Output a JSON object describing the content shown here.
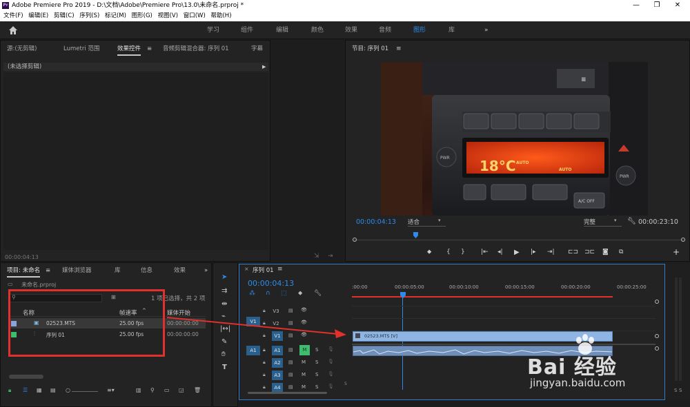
{
  "window": {
    "title": "Adobe Premiere Pro 2019 - D:\\文档\\Adobe\\Premiere Pro\\13.0\\未命名.prproj *",
    "app_badge": "Pr",
    "controls": [
      "—",
      "❐",
      "✕"
    ]
  },
  "menu": [
    "文件(F)",
    "编辑(E)",
    "剪辑(C)",
    "序列(S)",
    "标记(M)",
    "图形(G)",
    "视图(V)",
    "窗口(W)",
    "帮助(H)"
  ],
  "workspaces": {
    "items": [
      "学习",
      "组件",
      "编辑",
      "颜色",
      "效果",
      "音频",
      "图形",
      "库"
    ],
    "active": "图形",
    "more": "»"
  },
  "source_panel": {
    "tabs": [
      "源:(无剪辑)",
      "Lumetri 范围",
      "效果控件",
      "音频剪辑混合器: 序列 01",
      "字幕"
    ],
    "active_tab": "效果控件",
    "menu_glyph": "≡",
    "no_clip": "(未选择剪辑)",
    "timecode": "00:00:04:13"
  },
  "program_monitor": {
    "title": "节目: 序列 01",
    "timecode": "00:00:04:13",
    "fit": "适合",
    "quality": "完整",
    "duration": "00:00:23:10",
    "screen_text": [
      "AUTO",
      "AUTO",
      "18°C",
      "PWR",
      "PWR",
      "A/C OFF"
    ]
  },
  "project_panel": {
    "tabs": [
      "项目: 未命名",
      "媒体浏览器",
      "库",
      "信息",
      "效果"
    ],
    "active_tab": "项目: 未命名",
    "project_file": "未命名.prproj",
    "selection_info": "1 项已选择，共 2 项",
    "columns": [
      "名称",
      "帧速率",
      "媒体开始"
    ],
    "rows": [
      {
        "name": "02523.MTS",
        "fps": "25.00 fps",
        "start": "00:00:00:00",
        "color": "#8aa6d8"
      },
      {
        "name": "序列 01",
        "fps": "25.00 fps",
        "start": "00:00:00:00",
        "color": "#3fbd6e"
      }
    ]
  },
  "timeline": {
    "tab": "序列 01",
    "close": "×",
    "timecode": "00:00:04:13",
    "ruler": [
      ":00:00",
      "00:00:05:00",
      "00:00:10:00",
      "00:00:15:00",
      "00:00:20:00",
      "00:00:25:00"
    ],
    "video_tracks": [
      "V3",
      "V2",
      "V1"
    ],
    "audio_tracks": [
      "A1",
      "A2",
      "A3",
      "A4"
    ],
    "clip_label": "02523.MTS [V]",
    "mute": "M",
    "solo": "S",
    "meter_labels": [
      "S",
      "S"
    ]
  },
  "watermark": {
    "brand": "Bai 经验",
    "url": "jingyan.baidu.com"
  },
  "colors": {
    "accent": "#2d8ceb",
    "annotation": "#e0312c",
    "clip": "#8fb5e3"
  }
}
